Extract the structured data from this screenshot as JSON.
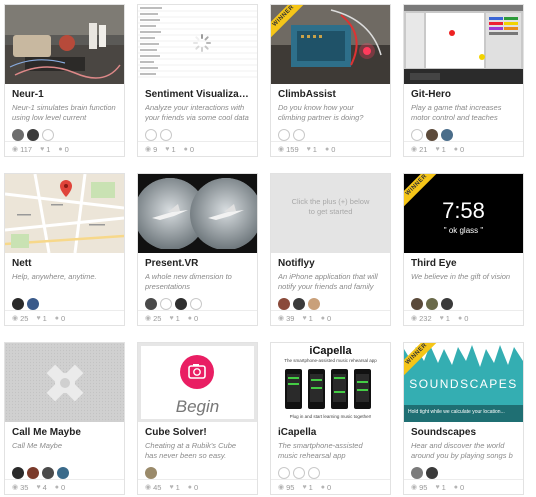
{
  "badge_label": "WINNER",
  "cards": [
    {
      "title": "Neur-1",
      "desc": "Neur-1 simulates brain function using low level current transmitt",
      "views": "117",
      "likes": "1",
      "comments": "0"
    },
    {
      "title": "Sentiment Visualization",
      "desc": "Analyze your interactions with your friends via some cool data",
      "views": "9",
      "likes": "1",
      "comments": "0"
    },
    {
      "title": "ClimbAssist",
      "desc": "Do you know how your climbing partner is doing? Never be out of",
      "views": "159",
      "likes": "1",
      "comments": "0"
    },
    {
      "title": "Git-Hero",
      "desc": "Play a game that increases motor control and teaches acoustic",
      "views": "21",
      "likes": "1",
      "comments": "0"
    },
    {
      "title": "Nett",
      "desc": "Help, anywhere, anytime.",
      "views": "25",
      "likes": "1",
      "comments": "0"
    },
    {
      "title": "Present.VR",
      "desc": "A whole new dimension to presentations",
      "views": "25",
      "likes": "1",
      "comments": "0"
    },
    {
      "title": "Notiflyy",
      "desc": "An iPhone application that will notify your friends and family",
      "views": "39",
      "likes": "1",
      "comments": "0",
      "placeholder": "Click the plus (+) below to get started"
    },
    {
      "title": "Third Eye",
      "desc": "We believe in the gift of vision",
      "views": "232",
      "likes": "1",
      "comments": "0",
      "screen_time": "7:58",
      "screen_sub": "\" ok glass \""
    },
    {
      "title": "Call Me Maybe",
      "desc": "Call Me Maybe",
      "views": "35",
      "likes": "4",
      "comments": "0"
    },
    {
      "title": "Cube Solver!",
      "desc": "Cheating at a Rubik's Cube has never been so easy.",
      "views": "45",
      "likes": "1",
      "comments": "0",
      "screen_word": "Begin"
    },
    {
      "title": "iCapella",
      "desc": "The smartphone-assisted music rehearsal app",
      "views": "95",
      "likes": "1",
      "comments": "0",
      "poster_title": "iCapella",
      "poster_sub": "The smartphone-assisted music rehearsal app",
      "poster_foot": "Plug in and start learning music together!"
    },
    {
      "title": "Soundscapes",
      "desc": "Hear and discover the world around you by playing songs b",
      "views": "95",
      "likes": "1",
      "comments": "0",
      "poster_title": "SOUNDSCAPES",
      "poster_foot": "Hold tight while we calculate your location..."
    }
  ]
}
